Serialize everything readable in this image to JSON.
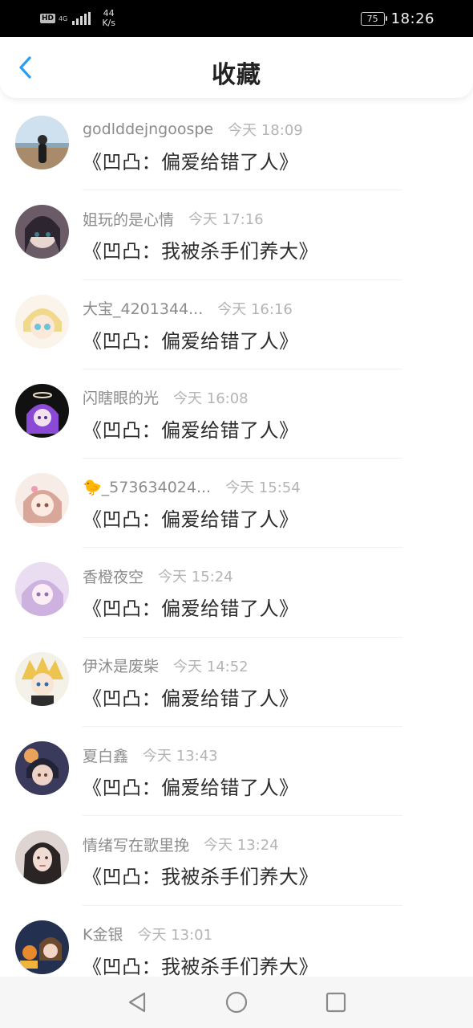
{
  "status_bar": {
    "hd": "HD",
    "network": "4G",
    "speed_value": "44",
    "speed_unit": "K/s",
    "battery": "75",
    "time": "18:26"
  },
  "header": {
    "title": "收藏",
    "back_icon": "chevron-left-icon",
    "accent_color": "#2a9df4"
  },
  "favorites": [
    {
      "username": "godlddejngoospe",
      "time": "今天 18:09",
      "book": "《凹凸：偏爱给错了人》",
      "avatar": "landscape-girl"
    },
    {
      "username": "姐玩的是心情",
      "time": "今天 17:16",
      "book": "《凹凸：我被杀手们养大》",
      "avatar": "anime-dark-hair"
    },
    {
      "username": "大宝_4201344...",
      "time": "今天 16:16",
      "book": "《凹凸：偏爱给错了人》",
      "avatar": "anime-blonde-chibi"
    },
    {
      "username": "闪瞎眼的光",
      "time": "今天 16:08",
      "book": "《凹凸：偏爱给错了人》",
      "avatar": "anime-purple-halo"
    },
    {
      "username": "🐤_573634024...",
      "time": "今天 15:54",
      "book": "《凹凸：偏爱给错了人》",
      "avatar": "anime-pink-girl"
    },
    {
      "username": "香橙夜空",
      "time": "今天 15:24",
      "book": "《凹凸：偏爱给错了人》",
      "avatar": "anime-lavender-girl"
    },
    {
      "username": "伊沐是废柴",
      "time": "今天 14:52",
      "book": "《凹凸：偏爱给错了人》",
      "avatar": "anime-blonde-boy"
    },
    {
      "username": "夏白鑫",
      "time": "今天 13:43",
      "book": "《凹凸：偏爱给错了人》",
      "avatar": "anime-dark-boy"
    },
    {
      "username": "情绪写在歌里挽",
      "time": "今天 13:24",
      "book": "《凹凸：我被杀手们养大》",
      "avatar": "realistic-girl"
    },
    {
      "username": "K金银",
      "time": "今天 13:01",
      "book": "《凹凸：我被杀手们养大》",
      "avatar": "anime-halloween"
    }
  ],
  "nav_bar": {
    "back": "triangle-back-icon",
    "home": "circle-home-icon",
    "recents": "square-recents-icon"
  }
}
